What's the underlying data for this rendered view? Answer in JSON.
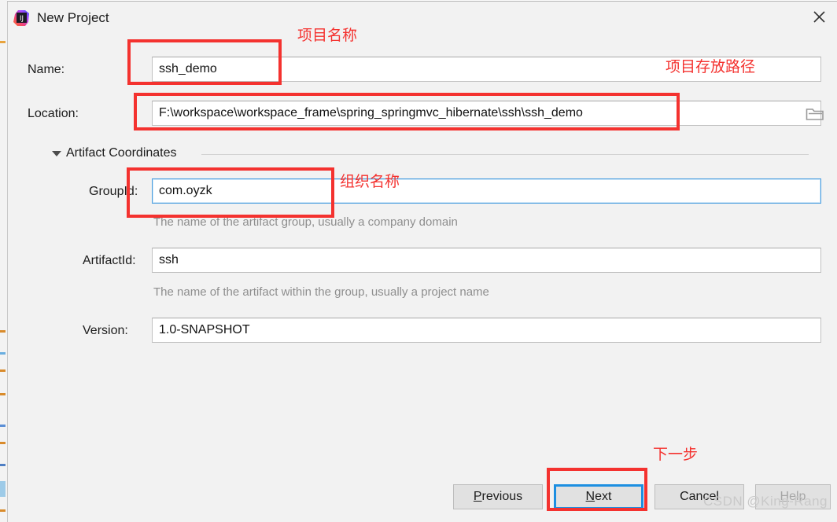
{
  "window": {
    "title": "New Project",
    "icon": "intellij-idea-logo",
    "close_label": "✕"
  },
  "form": {
    "name": {
      "label": "Name:",
      "value": "ssh_demo"
    },
    "location": {
      "label": "Location:",
      "value": "F:\\workspace\\workspace_frame\\spring_springmvc_hibernate\\ssh\\ssh_demo",
      "browse_icon": "folder-icon"
    },
    "artifact_section": {
      "title": "Artifact Coordinates",
      "expanded": true
    },
    "group_id": {
      "label": "GroupId:",
      "value": "com.oyzk",
      "hint": "The name of the artifact group, usually a company domain",
      "focused": true
    },
    "artifact_id": {
      "label": "ArtifactId:",
      "value": "ssh",
      "hint": "The name of the artifact within the group, usually a project name"
    },
    "version": {
      "label": "Version:",
      "value": "1.0-SNAPSHOT"
    }
  },
  "buttons": {
    "previous": {
      "label": "Previous",
      "mnemonic": "P"
    },
    "next": {
      "label": "Next",
      "mnemonic": "N",
      "focused": true
    },
    "cancel": {
      "label": "Cancel",
      "mnemonic": ""
    },
    "help": {
      "label": "Help",
      "mnemonic": "H",
      "disabled": true
    }
  },
  "annotations": {
    "color": "#f4322f",
    "project_name": "项目名称",
    "project_path": "项目存放路径",
    "organization_name": "组织名称",
    "next_step": "下一步"
  },
  "watermark": {
    "text": "CSDN @King-Rang"
  }
}
